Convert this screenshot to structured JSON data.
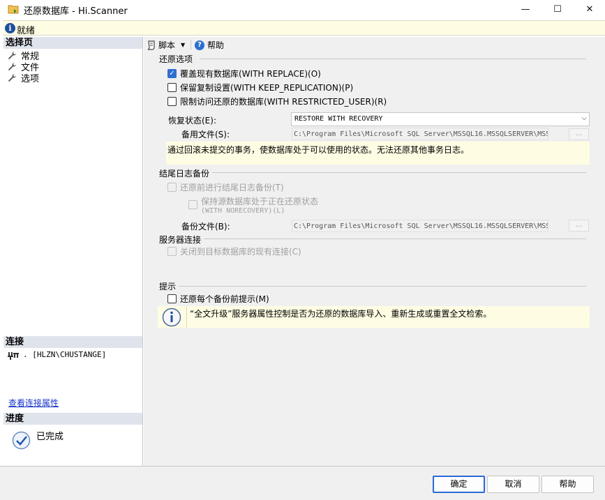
{
  "window": {
    "title": "还原数据库 - Hi.Scanner",
    "minimize_glyph": "—",
    "maximize_glyph": "☐",
    "close_glyph": "✕"
  },
  "status": {
    "text": "就绪",
    "icon": "info-icon"
  },
  "left_panel": {
    "select_page_header": "选择页",
    "pages": [
      {
        "label": "常规",
        "icon": "wrench-icon"
      },
      {
        "label": "文件",
        "icon": "wrench-icon"
      },
      {
        "label": "选项",
        "icon": "wrench-icon"
      }
    ],
    "connection_header": "连接",
    "connection_text": ". [HLZN\\CHUSTANGE]",
    "connection_link": "查看连接属性",
    "progress_header": "进度",
    "progress_text": "已完成"
  },
  "toolbar": {
    "script_label": "脚本",
    "help_label": "帮助"
  },
  "restore_options": {
    "section_title": "还原选项",
    "overwrite_label": "覆盖现有数据库(WITH REPLACE)(O)",
    "overwrite_checked": true,
    "keep_replication_label": "保留复制设置(WITH KEEP_REPLICATION)(P)",
    "keep_replication_checked": false,
    "restrict_access_label": "限制访问还原的数据库(WITH RESTRICTED_USER)(R)",
    "restrict_access_checked": false,
    "recovery_state_label": "恢复状态(E):",
    "recovery_state_value": "RESTORE WITH RECOVERY",
    "standby_file_label": "备用文件(S):",
    "standby_file_value": "C:\\Program Files\\Microsoft SQL Server\\MSSQL16.MSSQLSERVER\\MSS",
    "browse_label": "...",
    "recovery_note": "通过回滚未提交的事务，使数据库处于可以使用的状态。无法还原其他事务日志。"
  },
  "tail_log": {
    "section_title": "结尾日志备份",
    "take_tail_label": "还原前进行结尾日志备份(T)",
    "leave_restoring_line1": "保持源数据库处于正在还原状态",
    "leave_restoring_line2": "(WITH NORECOVERY)(L)",
    "backup_file_label": "备份文件(B):",
    "backup_file_value": "C:\\Program Files\\Microsoft SQL Server\\MSSQL16.MSSQLSERVER\\MSS",
    "browse_label": "..."
  },
  "server_connection": {
    "section_title": "服务器连接",
    "close_connections_label": "关闭到目标数据库的现有连接(C)"
  },
  "prompt": {
    "section_title": "提示",
    "prompt_label": "还原每个备份前提示(M)",
    "info_note": "“全文升级”服务器属性控制是否为还原的数据库导入、重新生成或重置全文检索。"
  },
  "buttons": {
    "ok": "确定",
    "cancel": "取消",
    "help": "帮助"
  }
}
